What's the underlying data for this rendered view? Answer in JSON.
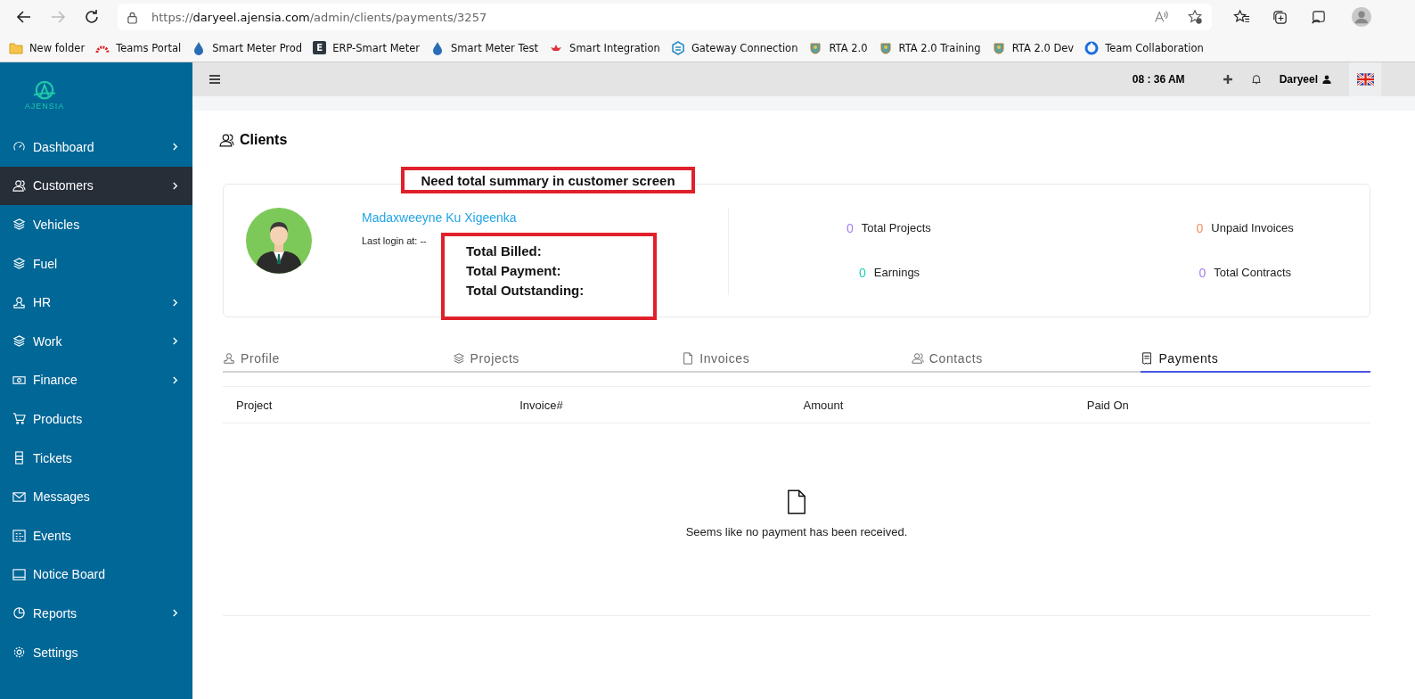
{
  "browser": {
    "url_prefix": "https://",
    "url_host": "daryeel.ajensia.com",
    "url_path": "/admin/clients/payments/3257",
    "bookmarks": [
      {
        "label": "New folder",
        "kind": "folder"
      },
      {
        "label": "Teams Portal",
        "kind": "arc"
      },
      {
        "label": "Smart Meter Prod",
        "kind": "drop"
      },
      {
        "label": "ERP-Smart Meter",
        "kind": "letter",
        "glyph": "E"
      },
      {
        "label": "Smart Meter Test",
        "kind": "drop"
      },
      {
        "label": "Smart Integration",
        "kind": "flower"
      },
      {
        "label": "Gateway Connection",
        "kind": "hex"
      },
      {
        "label": "RTA 2.0",
        "kind": "crest"
      },
      {
        "label": "RTA 2.0 Training",
        "kind": "crest"
      },
      {
        "label": "RTA 2.0 Dev",
        "kind": "crest"
      },
      {
        "label": "Team Collaboration",
        "kind": "ring"
      }
    ]
  },
  "logo": {
    "text": "AJENSIA"
  },
  "sidebar": {
    "items": [
      {
        "label": "Dashboard",
        "kind": "gauge",
        "expandable": true,
        "selected": false
      },
      {
        "label": "Customers",
        "kind": "users",
        "expandable": true,
        "selected": true
      },
      {
        "label": "Vehicles",
        "kind": "layers",
        "expandable": false,
        "selected": false
      },
      {
        "label": "Fuel",
        "kind": "layers",
        "expandable": false,
        "selected": false
      },
      {
        "label": "HR",
        "kind": "user",
        "expandable": true,
        "selected": false
      },
      {
        "label": "Work",
        "kind": "layers",
        "expandable": true,
        "selected": false
      },
      {
        "label": "Finance",
        "kind": "money",
        "expandable": true,
        "selected": false
      },
      {
        "label": "Products",
        "kind": "cart",
        "expandable": false,
        "selected": false
      },
      {
        "label": "Tickets",
        "kind": "ticket",
        "expandable": false,
        "selected": false
      },
      {
        "label": "Messages",
        "kind": "mail",
        "expandable": false,
        "selected": false
      },
      {
        "label": "Events",
        "kind": "calendar",
        "expandable": false,
        "selected": false
      },
      {
        "label": "Notice Board",
        "kind": "board",
        "expandable": false,
        "selected": false
      },
      {
        "label": "Reports",
        "kind": "pie",
        "expandable": true,
        "selected": false
      },
      {
        "label": "Settings",
        "kind": "gear",
        "expandable": false,
        "selected": false
      }
    ]
  },
  "topbar": {
    "time": "08 : 36 AM",
    "user": "Daryeel"
  },
  "page": {
    "title": "Clients"
  },
  "client": {
    "name": "Madaxweeyne Ku Xigeenka",
    "last_login": "Last login at: --"
  },
  "stats": [
    {
      "value": "0",
      "label": "Total Projects",
      "color": "#a57cf0"
    },
    {
      "value": "0",
      "label": "Unpaid Invoices",
      "color": "#fb8c5c"
    },
    {
      "value": "0",
      "label": "Earnings",
      "color": "#1bcfb4"
    },
    {
      "value": "0",
      "label": "Total Contracts",
      "color": "#a57cf0"
    }
  ],
  "annotations": {
    "title": "Need total summary in customer screen",
    "lines": [
      "Total Billed:",
      "Total Payment:",
      "Total Outstanding:"
    ]
  },
  "tabs": [
    {
      "label": "Profile",
      "kind": "user",
      "selected": false
    },
    {
      "label": "Projects",
      "kind": "layers",
      "selected": false
    },
    {
      "label": "Invoices",
      "kind": "file",
      "selected": false
    },
    {
      "label": "Contacts",
      "kind": "users",
      "selected": false
    },
    {
      "label": "Payments",
      "kind": "receipt",
      "selected": true
    }
  ],
  "table": {
    "columns": [
      "Project",
      "Invoice#",
      "Amount",
      "Paid On"
    ],
    "empty_message": "Seems like no payment has been received."
  }
}
